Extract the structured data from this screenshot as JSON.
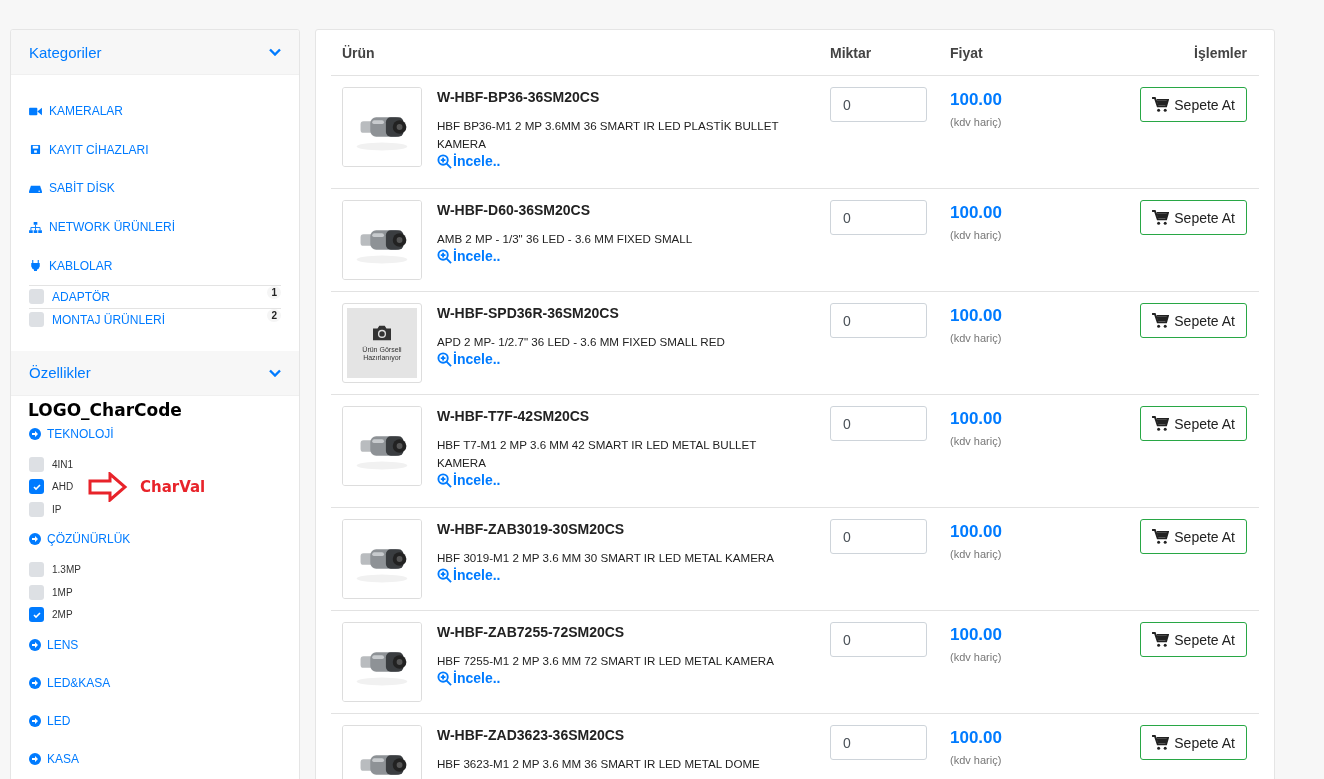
{
  "sidebar": {
    "categories": {
      "title": "Kategoriler",
      "expanded": true,
      "items": [
        {
          "label": "KAMERALAR"
        },
        {
          "label": "KAYIT CİHAZLARI"
        },
        {
          "label": "SABİT DİSK"
        },
        {
          "label": "NETWORK ÜRÜNLERİ"
        },
        {
          "label": "KABLOLAR"
        }
      ],
      "subitems": [
        {
          "label": "ADAPTÖR",
          "count": "1",
          "checked": false
        },
        {
          "label": "MONTAJ ÜRÜNLERİ",
          "count": "2",
          "checked": false
        }
      ]
    },
    "features": {
      "title": "Özellikler",
      "expanded": true,
      "groups": [
        {
          "label": "TEKNOLOJİ",
          "options": [
            {
              "label": "4IN1",
              "checked": false
            },
            {
              "label": "AHD",
              "checked": true
            },
            {
              "label": "IP",
              "checked": false
            }
          ]
        },
        {
          "label": "ÇÖZÜNÜRLÜK",
          "options": [
            {
              "label": "1.3MP",
              "checked": false
            },
            {
              "label": "1MP",
              "checked": false
            },
            {
              "label": "2MP",
              "checked": true
            }
          ]
        },
        {
          "label": "LENS"
        },
        {
          "label": "LED&KASA"
        },
        {
          "label": "LED"
        },
        {
          "label": "KASA"
        }
      ]
    },
    "annotations": {
      "code_label": "LOGO_CharCode",
      "value_label": "CharVal"
    }
  },
  "table": {
    "columns": [
      "Ürün",
      "Miktar",
      "Fiyat",
      "İşlemler"
    ],
    "rows": [
      {
        "code": "W-HBF-BP36-36SM20CS",
        "description": "HBF BP36-M1 2 MP 3.6MM 36 SMART IR LED PLASTİK BULLET KAMERA",
        "link": "İncele..",
        "quantity": "0",
        "price": "100.00",
        "tax_note": "(kdv hariç)",
        "button": "Sepete At"
      },
      {
        "code": "W-HBF-D60-36SM20CS",
        "description": "AMB 2 MP - 1/3\" 36 LED - 3.6 MM FIXED SMALL",
        "link": "İncele..",
        "quantity": "0",
        "price": "100.00",
        "tax_note": "(kdv hariç)",
        "button": "Sepete At"
      },
      {
        "image": {
          "kind": "placeholder",
          "text": "Ürün Görseli Hazırlanıyor"
        },
        "code": "W-HBF-SPD36R-36SM20CS",
        "description": "APD 2 MP- 1/2.7\" 36 LED - 3.6 MM FIXED SMALL RED",
        "link": "İncele..",
        "quantity": "0",
        "price": "100.00",
        "tax_note": "(kdv hariç)",
        "button": "Sepete At"
      },
      {
        "code": "W-HBF-T7F-42SM20CS",
        "description": "HBF T7-M1 2 MP 3.6 MM 42 SMART IR LED METAL BULLET KAMERA",
        "link": "İncele..",
        "quantity": "0",
        "price": "100.00",
        "tax_note": "(kdv hariç)",
        "button": "Sepete At"
      },
      {
        "code": "W-HBF-ZAB3019-30SM20CS",
        "description": "HBF 3019-M1 2 MP 3.6 MM 30 SMART IR LED METAL KAMERA",
        "link": "İncele..",
        "quantity": "0",
        "price": "100.00",
        "tax_note": "(kdv hariç)",
        "button": "Sepete At"
      },
      {
        "code": "W-HBF-ZAB7255-72SM20CS",
        "description": "HBF 7255-M1 2 MP 3.6 MM 72 SMART IR LED METAL KAMERA",
        "link": "İncele..",
        "quantity": "0",
        "price": "100.00",
        "tax_note": "(kdv hariç)",
        "button": "Sepete At"
      },
      {
        "code": "W-HBF-ZAD3623-36SM20CS",
        "description": "HBF 3623-M1 2 MP 3.6 MM 36 SMART IR LED METAL DOME",
        "quantity": "0",
        "price": "100.00",
        "tax_note": "(kdv hariç)",
        "button": "Sepete At"
      }
    ]
  }
}
